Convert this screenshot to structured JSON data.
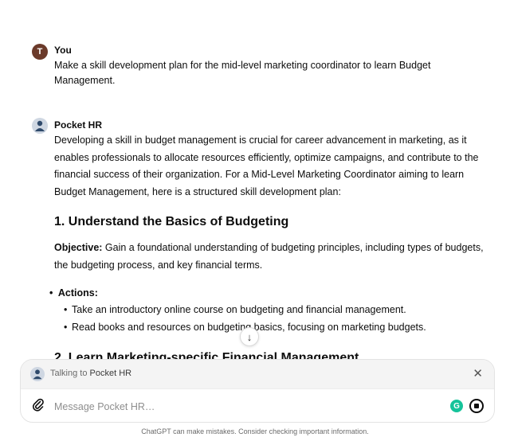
{
  "user_message": {
    "avatar_initial": "T",
    "author": "You",
    "text": "Make a skill development plan for the mid-level marketing coordinator to learn Budget Management."
  },
  "bot_message": {
    "author": "Pocket HR",
    "intro": "Developing a skill in budget management is crucial for career advancement in marketing, as it enables professionals to allocate resources efficiently, optimize campaigns, and contribute to the financial success of their organization. For a Mid-Level Marketing Coordinator aiming to learn Budget Management, here is a structured skill development plan:",
    "section_heading": "1. Understand the Basics of Budgeting",
    "objective_label": "Objective:",
    "objective_text": " Gain a foundational understanding of budgeting principles, including types of budgets, the budgeting process, and key financial terms.",
    "actions_label": "Actions:",
    "actions": [
      "Take an introductory online course on budgeting and financial management.",
      "Read books and resources on budgeting basics, focusing on marketing budgets."
    ],
    "next_heading_partial": "2. Learn Marketing-specific Financial Management"
  },
  "scroll_down_icon": "arrow-down-icon",
  "composer": {
    "talking_prefix": "Talking to ",
    "talking_name": "Pocket HR",
    "close_icon": "close-icon",
    "attach_icon": "paperclip-icon",
    "placeholder": "Message Pocket HR…",
    "grammarly_icon": "grammarly-icon",
    "stop_icon": "stop-icon"
  },
  "disclaimer": "ChatGPT can make mistakes. Consider checking important information.",
  "colors": {
    "user_avatar": "#6b3a2a",
    "grammarly": "#15c39a",
    "text": "#0d0d0d"
  }
}
